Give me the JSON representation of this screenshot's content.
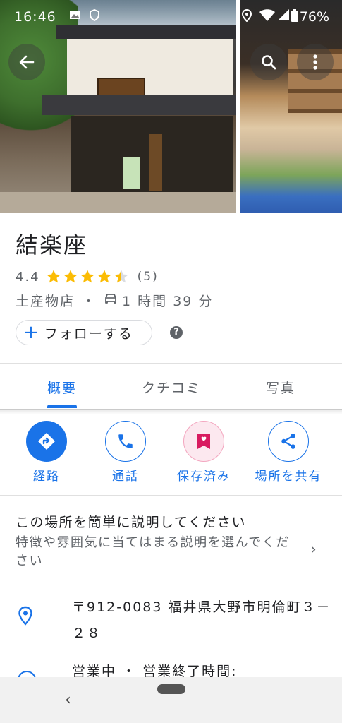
{
  "status_bar": {
    "time": "16:46",
    "battery": "76%"
  },
  "place": {
    "name": "結楽座",
    "rating": "4.4",
    "rating_value": 4.4,
    "rating_max": 5,
    "review_count": "(5)",
    "category": "土産物店",
    "separator": "・",
    "travel_time": "1 時間 39 分"
  },
  "follow": {
    "label": "フォローする"
  },
  "tabs": [
    {
      "label": "概要"
    },
    {
      "label": "クチコミ"
    },
    {
      "label": "写真"
    }
  ],
  "actions": [
    {
      "label": "経路"
    },
    {
      "label": "通話"
    },
    {
      "label": "保存済み"
    },
    {
      "label": "場所を共有"
    }
  ],
  "description": {
    "title": "この場所を簡単に説明してください",
    "subtitle": "特徴や雰囲気に当てはまる説明を選んでください"
  },
  "address": {
    "text": "〒912-0083 福井県大野市明倫町３－２８"
  },
  "hours": {
    "text": "営業中 ・ 営業終了時間:"
  },
  "colors": {
    "accent": "#1a73e8",
    "star": "#fbbc04",
    "save": "#d81b60"
  }
}
